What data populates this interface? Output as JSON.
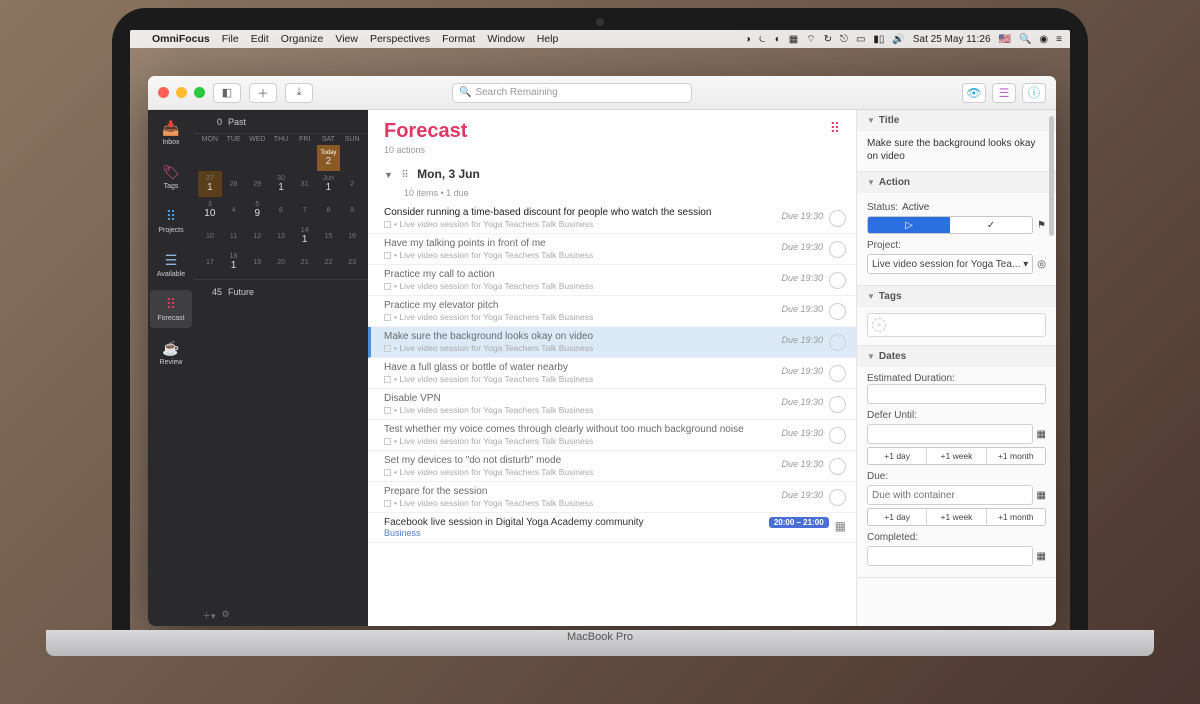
{
  "menubar": {
    "app": "OmniFocus",
    "items": [
      "File",
      "Edit",
      "Organize",
      "View",
      "Perspectives",
      "Format",
      "Window",
      "Help"
    ],
    "clock": "Sat 25 May  11:26"
  },
  "toolbar": {
    "search_placeholder": "Search Remaining"
  },
  "sidebar": {
    "items": [
      {
        "label": "Inbox"
      },
      {
        "label": "Tags"
      },
      {
        "label": "Projects"
      },
      {
        "label": "Available"
      },
      {
        "label": "Forecast"
      },
      {
        "label": "Review"
      }
    ]
  },
  "calendar": {
    "past": {
      "count": "0",
      "label": "Past"
    },
    "future": {
      "count": "45",
      "label": "Future"
    },
    "day_headers": [
      "MON",
      "TUE",
      "WED",
      "THU",
      "FRI",
      "SAT",
      "SUN"
    ],
    "rows": [
      [
        {
          "d": ""
        },
        {
          "d": ""
        },
        {
          "d": ""
        },
        {
          "d": ""
        },
        {
          "d": ""
        },
        {
          "d": "Today",
          "c": "2",
          "today": true
        },
        {
          "d": ""
        }
      ],
      [
        {
          "d": "27",
          "c": "1",
          "sel": true
        },
        {
          "d": "28",
          "c": ""
        },
        {
          "d": "29",
          "c": ""
        },
        {
          "d": "30",
          "c": "1"
        },
        {
          "d": "31",
          "c": ""
        },
        {
          "d": "Jun",
          "c": "1"
        },
        {
          "d": "2",
          "c": ""
        }
      ],
      [
        {
          "d": "3",
          "c": "10"
        },
        {
          "d": "4",
          "c": ""
        },
        {
          "d": "5",
          "c": "9"
        },
        {
          "d": "6",
          "c": ""
        },
        {
          "d": "7",
          "c": ""
        },
        {
          "d": "8",
          "c": ""
        },
        {
          "d": "9",
          "c": ""
        }
      ],
      [
        {
          "d": "10",
          "c": ""
        },
        {
          "d": "11",
          "c": ""
        },
        {
          "d": "12",
          "c": ""
        },
        {
          "d": "13",
          "c": ""
        },
        {
          "d": "14",
          "c": "1"
        },
        {
          "d": "15",
          "c": ""
        },
        {
          "d": "16",
          "c": ""
        }
      ],
      [
        {
          "d": "17",
          "c": ""
        },
        {
          "d": "18",
          "c": "1"
        },
        {
          "d": "19",
          "c": ""
        },
        {
          "d": "20",
          "c": ""
        },
        {
          "d": "21",
          "c": ""
        },
        {
          "d": "22",
          "c": ""
        },
        {
          "d": "23",
          "c": ""
        }
      ]
    ]
  },
  "content": {
    "title": "Forecast",
    "subtitle": "10 actions",
    "group_date": "Mon, 3 Jun",
    "group_meta": "10 items • 1 due",
    "project_line": "• Live video session for Yoga Teachers Talk Business",
    "due_label": "Due 19:30",
    "tasks": [
      {
        "title": "Consider running a time-based discount for people who watch the session",
        "first": true
      },
      {
        "title": "Have my talking points in front of me"
      },
      {
        "title": "Practice my call to action"
      },
      {
        "title": "Practice my elevator pitch"
      },
      {
        "title": "Make sure the background looks okay on video",
        "selected": true
      },
      {
        "title": "Have a full glass or bottle of water nearby"
      },
      {
        "title": "Disable VPN"
      },
      {
        "title": "Test whether my voice comes through clearly without too much background noise"
      },
      {
        "title": "Set my devices to \"do not disturb\" mode"
      },
      {
        "title": "Prepare for the session"
      }
    ],
    "event": {
      "title": "Facebook live session in Digital Yoga Academy community",
      "project": "Business",
      "time": "20:00 – 21:00"
    }
  },
  "inspector": {
    "title_label": "Title",
    "title_value": "Make sure the background looks okay on video",
    "action_label": "Action",
    "status_label": "Status:",
    "status_value": "Active",
    "project_label": "Project:",
    "project_value": "Live video session for Yoga Tea...",
    "tags_label": "Tags",
    "dates_label": "Dates",
    "est_label": "Estimated Duration:",
    "defer_label": "Defer Until:",
    "due_label": "Due:",
    "due_placeholder": "Due with container",
    "completed_label": "Completed:",
    "quick": [
      "+1 day",
      "+1 week",
      "+1 month"
    ]
  },
  "laptop": "MacBook Pro"
}
